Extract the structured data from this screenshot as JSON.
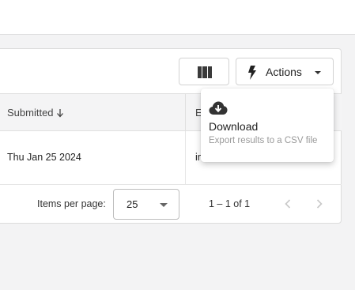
{
  "toolbar": {
    "columns_icon": "view-column-icon",
    "actions_label": "Actions",
    "actions_icon": "bolt-icon",
    "actions_caret_icon": "caret-down-icon"
  },
  "table": {
    "columns": [
      {
        "label": "Submitted",
        "sort_icon": "arrow-down-icon"
      },
      {
        "label": "E"
      }
    ],
    "rows": [
      {
        "submitted": "Thu Jan 25 2024",
        "email": "in"
      }
    ]
  },
  "paginator": {
    "items_per_page_label": "Items per page:",
    "page_size": "25",
    "range_label": "1 – 1 of 1",
    "prev_icon": "chevron-left-icon",
    "next_icon": "chevron-right-icon"
  },
  "actions_menu": {
    "items": [
      {
        "icon": "cloud-download-icon",
        "title": "Download",
        "description": "Export results to a CSV file"
      }
    ]
  },
  "colors": {
    "page_background": "#f3f3f4",
    "header_background": "#f4f4f5",
    "muted_text": "#9a9a9a"
  }
}
